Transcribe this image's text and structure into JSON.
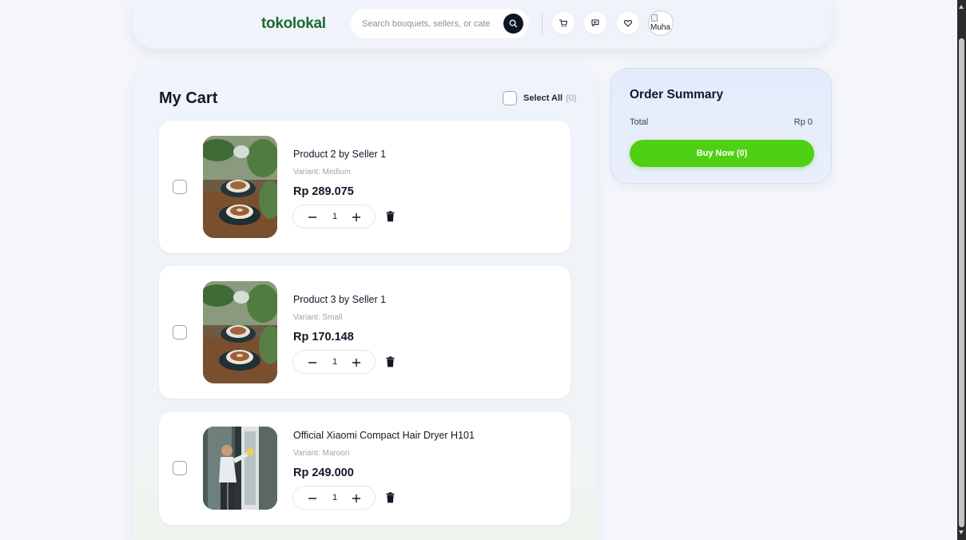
{
  "header": {
    "logo": "tokolokal",
    "search_placeholder": "Search bouquets, sellers, or categories",
    "avatar_alt": "Muha"
  },
  "cart": {
    "title": "My Cart",
    "select_all_label": "Select All",
    "select_all_count": "(0)",
    "items": [
      {
        "name": "Product 2 by Seller 1",
        "variant": "Variant: Medium",
        "price": "Rp 289.075",
        "quantity": "1",
        "image": "coffee-cups-plants"
      },
      {
        "name": "Product 3 by Seller 1",
        "variant": "Variant: Small",
        "price": "Rp 170.148",
        "quantity": "1",
        "image": "coffee-cups-plants"
      },
      {
        "name": "Official Xiaomi Compact Hair Dryer H101",
        "variant": "Variant: Maroon",
        "price": "Rp 249.000",
        "quantity": "1",
        "image": "person-cleaning-window"
      }
    ]
  },
  "summary": {
    "title": "Order Summary",
    "total_label": "Total",
    "total_value": "Rp 0",
    "buy_label": "Buy Now (0)"
  },
  "icons": {
    "search": "search-icon",
    "cart": "cart-icon",
    "chat": "chat-icon",
    "wishlist": "wishlist-icon",
    "minus": "minus-icon",
    "plus": "plus-icon",
    "trash": "trash-icon"
  },
  "colors": {
    "brand": "#1d6b2f",
    "accent": "#4fd012",
    "dark": "#0e1524"
  }
}
